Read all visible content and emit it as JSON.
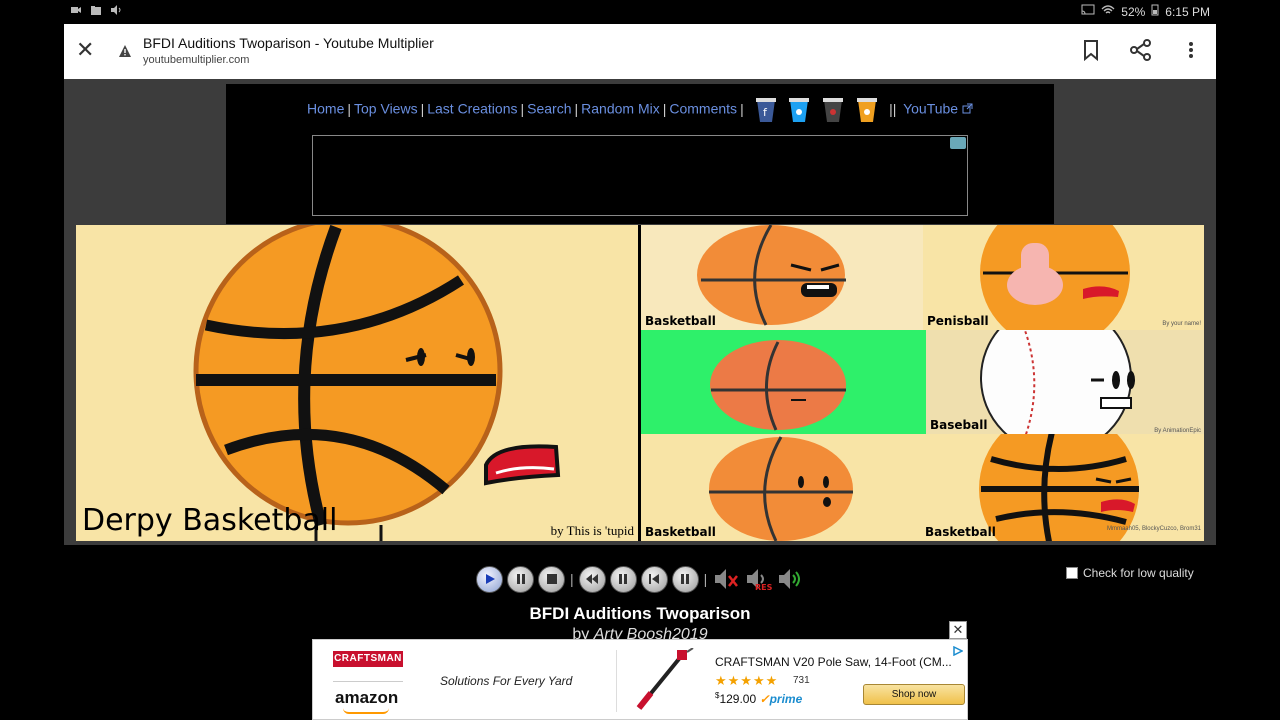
{
  "status_bar": {
    "battery": "52%",
    "time": "6:15 PM"
  },
  "tab": {
    "title": "BFDI Auditions Twoparison - Youtube Multiplier",
    "url": "youtubemultiplier.com"
  },
  "nav": {
    "items": [
      "Home",
      "Top Views",
      "Last Creations",
      "Search",
      "Random Mix",
      "Comments"
    ],
    "youtube": "YouTube",
    "double_sep": "||"
  },
  "video": {
    "left_caption": "Derpy Basketball",
    "left_credit": "by This is 'tupid",
    "cells": [
      "Basketball",
      "Penisball",
      "Baseball",
      "Basketball",
      "Basketball"
    ],
    "credit_small_1": "By your name!",
    "credit_small_2": "By AnimationEpic",
    "credit_small_3": "Mmmaah05, BlockyCuzco, Brom31"
  },
  "player": {
    "low_quality_label": "Check for low quality",
    "res_label": "RES"
  },
  "video_info": {
    "title": "BFDI Auditions Twoparison",
    "by_prefix": "by",
    "author": "Arty Boosh2019"
  },
  "ad": {
    "brand": "CRAFTSMAN",
    "retailer": "amazon",
    "slogan": "Solutions For Every Yard",
    "product_title": "CRAFTSMAN V20 Pole Saw, 14-Foot (CM...",
    "stars": "★★★★★",
    "rating_fraction": 0.9,
    "review_count": "731",
    "price_symbol": "$",
    "price": "129.00",
    "prime": "prime",
    "shop_label": "Shop now",
    "close": "✕"
  },
  "colors": {
    "nav_link": "#6a8fe0",
    "page_bg": "#3c3c3c",
    "frame_bg": "#f8e4a6",
    "green_screen": "#2ef06a",
    "ball_orange": "#f59a23"
  }
}
